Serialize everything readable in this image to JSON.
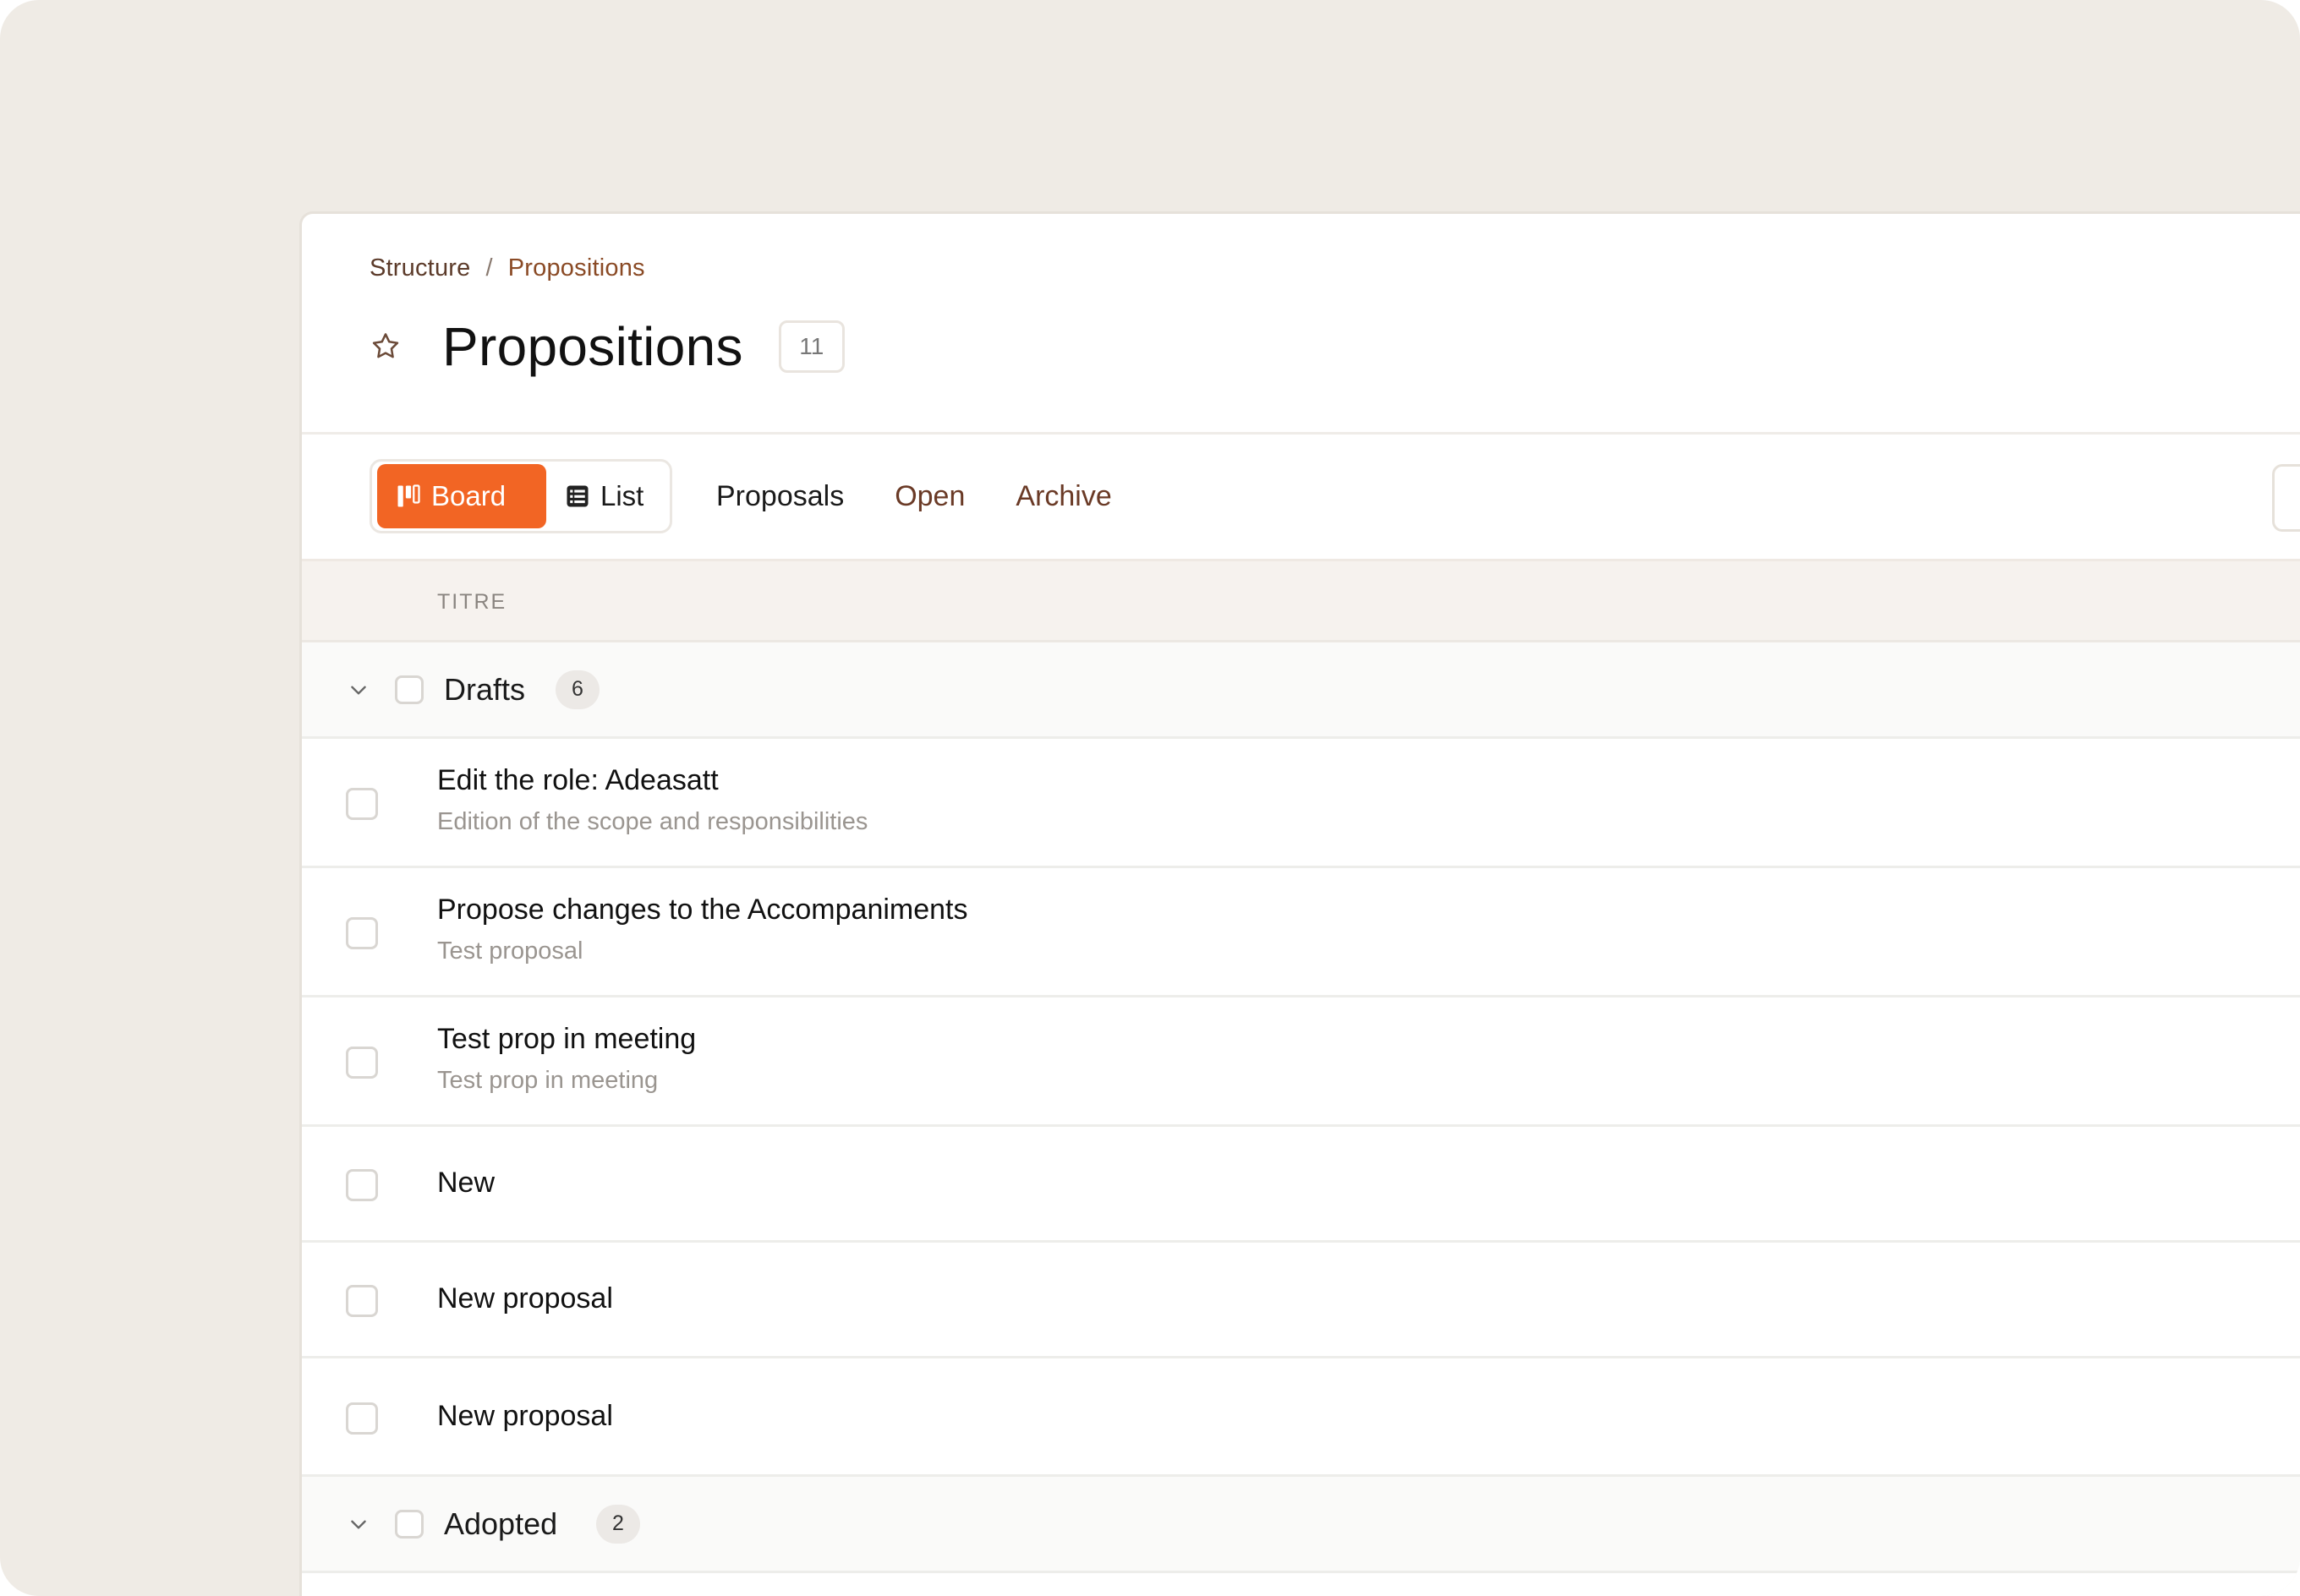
{
  "breadcrumb": {
    "root": "Structure",
    "separator": "/",
    "current": "Propositions"
  },
  "page": {
    "title": "Propositions",
    "count": "11"
  },
  "view_switch": {
    "board_label": "Board",
    "list_label": "List",
    "active": "board"
  },
  "tabs": [
    {
      "label": "Proposals",
      "active": true
    },
    {
      "label": "Open",
      "active": false
    },
    {
      "label": "Archive",
      "active": false
    }
  ],
  "table": {
    "column_title": "TITRE"
  },
  "groups": [
    {
      "label": "Drafts",
      "count": "6"
    },
    {
      "label": "Adopted",
      "count": "2"
    }
  ],
  "items": [
    {
      "title": "Edit the role: Adeasatt",
      "subtitle": "Edition of the scope and responsibilities"
    },
    {
      "title": "Propose changes to the Accompaniments",
      "subtitle": "Test proposal"
    },
    {
      "title": "Test prop in meeting",
      "subtitle": "Test prop in meeting"
    },
    {
      "title": "New",
      "subtitle": ""
    },
    {
      "title": "New proposal",
      "subtitle": ""
    },
    {
      "title": "New proposal",
      "subtitle": ""
    }
  ],
  "colors": {
    "accent": "#f26524",
    "background": "#efebe5",
    "tab_text": "#6a3a26"
  },
  "icons": {
    "favorite": "star-icon",
    "board": "kanban-icon",
    "list": "list-icon",
    "expand": "chevron-down-icon"
  }
}
